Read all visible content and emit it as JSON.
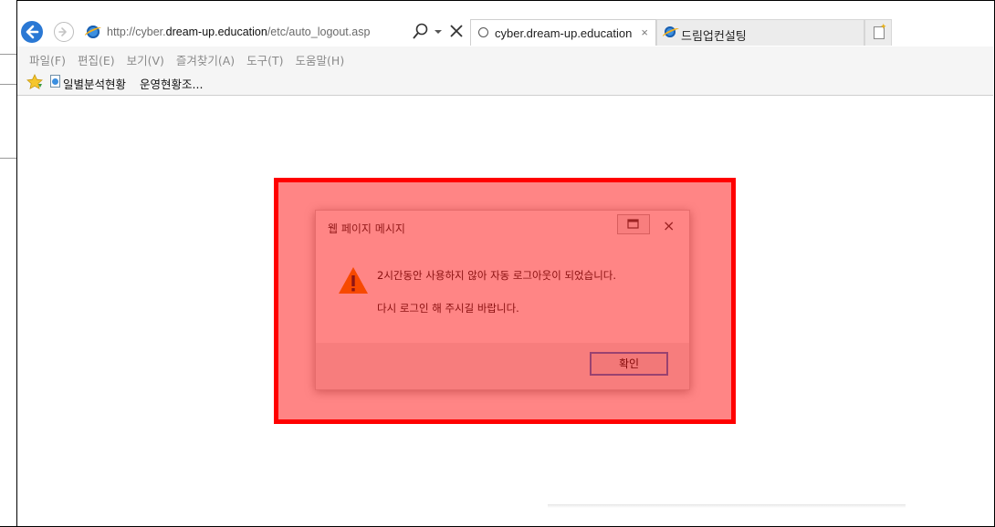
{
  "browser": {
    "address_bar": {
      "url_prefix": "http://cyber.",
      "url_host": "dream-up.education",
      "url_path": "/etc/auto_logout.asp"
    },
    "tabs": [
      {
        "label": "cyber.dream-up.education",
        "close": "×",
        "state": "loading"
      },
      {
        "label": "드림업컨설팅",
        "state": "inactive"
      }
    ],
    "menu": [
      "파일(F)",
      "편집(E)",
      "보기(V)",
      "즐겨찾기(A)",
      "도구(T)",
      "도움말(H)"
    ],
    "favorites": [
      "일별분석현황",
      "운영현황조..."
    ]
  },
  "dialog": {
    "title": "웹 페이지 메시지",
    "message_line1": "2시간동안 사용하지 않아 자동 로그아웃이 되었습니다.",
    "message_line2": "다시 로그인 해 주시길 바랍니다.",
    "ok_label": "확인",
    "close_glyph": "×"
  },
  "colors": {
    "highlight": "#ff0000",
    "back_button": "#2a78d4",
    "focus_border": "#3c7fd6",
    "warning": "#f08c00"
  },
  "icons": {
    "back": "back-arrow-icon",
    "forward": "forward-arrow-icon",
    "site": "ie-icon",
    "search": "search-icon",
    "dropdown": "dropdown-icon",
    "stop": "stop-icon",
    "favorites": "favorites-star-icon",
    "warning": "warning-icon"
  }
}
